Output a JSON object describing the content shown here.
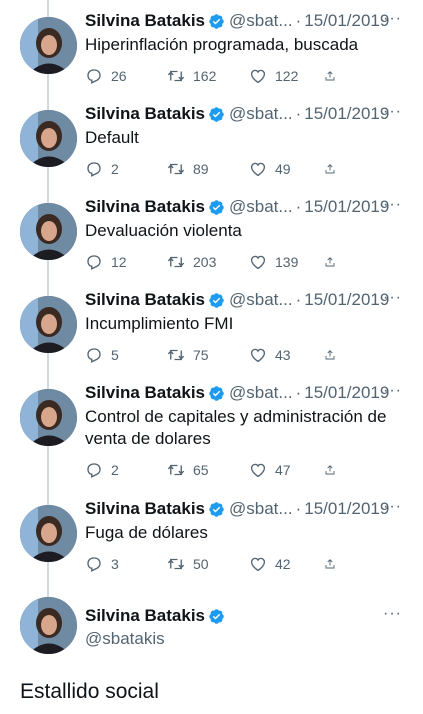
{
  "author": {
    "name": "Silvina Batakis",
    "handle_short": "@sbat...",
    "handle_full": "@sbatakis"
  },
  "tweets": [
    {
      "date": "15/01/2019",
      "text": "Hiperinflación programada, buscada",
      "replies": "26",
      "retweets": "162",
      "likes": "122"
    },
    {
      "date": "15/01/2019",
      "text": "Default",
      "replies": "2",
      "retweets": "89",
      "likes": "49"
    },
    {
      "date": "15/01/2019",
      "text": "Devaluación violenta",
      "replies": "12",
      "retweets": "203",
      "likes": "139"
    },
    {
      "date": "15/01/2019",
      "text": "Incumplimiento FMI",
      "replies": "5",
      "retweets": "75",
      "likes": "43"
    },
    {
      "date": "15/01/2019",
      "text": "Control de capitales y administración de venta de dolares",
      "replies": "2",
      "retweets": "65",
      "likes": "47"
    },
    {
      "date": "15/01/2019",
      "text": "Fuga de dólares",
      "replies": "3",
      "retweets": "50",
      "likes": "42"
    }
  ],
  "main_tweet": {
    "text": "Estallido social"
  },
  "ui": {
    "separator": "·",
    "more": "···"
  },
  "icons": {
    "verified": "verified-badge-icon",
    "reply": "reply-icon",
    "retweet": "retweet-icon",
    "like": "heart-icon",
    "share": "share-icon",
    "more": "more-icon"
  },
  "colors": {
    "verified_blue": "#1d9bf0",
    "secondary_text": "#536471",
    "thread_line": "#cfd9de"
  }
}
